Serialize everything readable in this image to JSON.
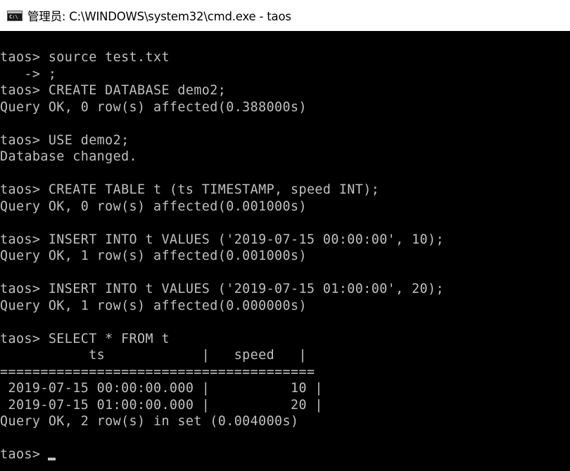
{
  "window": {
    "title": "管理员: C:\\WINDOWS\\system32\\cmd.exe - taos",
    "icon": "cmd-icon",
    "colors": {
      "titlebar_background": "#ffffff",
      "title_text": "#000000",
      "console_background": "#000000",
      "console_text": "#c0c0c0"
    }
  },
  "console": {
    "lines": [
      "taos> source test.txt",
      "   -> ;",
      "taos> CREATE DATABASE demo2;",
      "Query OK, 0 row(s) affected(0.388000s)",
      "",
      "taos> USE demo2;",
      "Database changed.",
      "",
      "taos> CREATE TABLE t (ts TIMESTAMP, speed INT);",
      "Query OK, 0 row(s) affected(0.001000s)",
      "",
      "taos> INSERT INTO t VALUES ('2019-07-15 00:00:00', 10);",
      "Query OK, 1 row(s) affected(0.001000s)",
      "",
      "taos> INSERT INTO t VALUES ('2019-07-15 01:00:00', 20);",
      "Query OK, 1 row(s) affected(0.000000s)",
      "",
      "taos> SELECT * FROM t",
      "           ts            |   speed   |",
      "=======================================",
      " 2019-07-15 00:00:00.000 |          10 |",
      " 2019-07-15 01:00:00.000 |          20 |",
      "Query OK, 2 row(s) in set (0.004000s)",
      "",
      "taos> "
    ],
    "cursor": "block-cursor"
  }
}
